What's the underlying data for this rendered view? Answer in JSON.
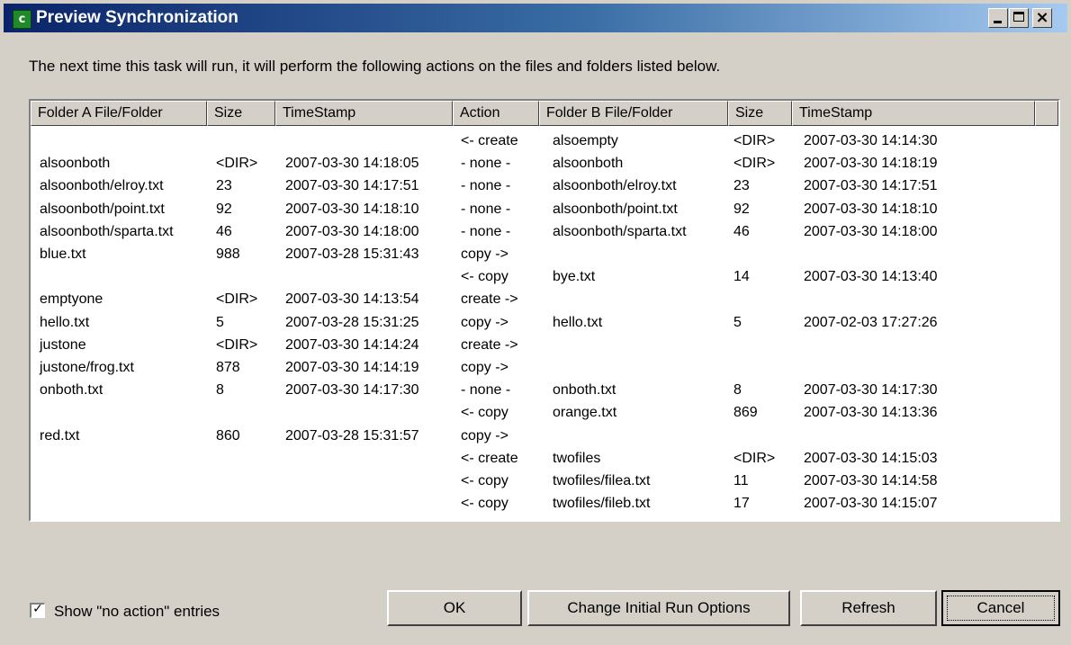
{
  "window": {
    "title": "Preview Synchronization"
  },
  "intro": "The next time this task will run, it will perform the following actions on the files and folders listed below.",
  "columns": [
    "Folder A File/Folder",
    "Size",
    "TimeStamp",
    "Action",
    "Folder B File/Folder",
    "Size",
    "TimeStamp"
  ],
  "rows": [
    [
      "",
      "",
      "",
      "<- create",
      "alsoempty",
      "<DIR>",
      "2007-03-30 14:14:30"
    ],
    [
      "alsoonboth",
      "<DIR>",
      "2007-03-30 14:18:05",
      "- none -",
      "alsoonboth",
      "<DIR>",
      "2007-03-30 14:18:19"
    ],
    [
      "alsoonboth/elroy.txt",
      "23",
      "2007-03-30 14:17:51",
      "- none -",
      "alsoonboth/elroy.txt",
      "23",
      "2007-03-30 14:17:51"
    ],
    [
      "alsoonboth/point.txt",
      "92",
      "2007-03-30 14:18:10",
      "- none -",
      "alsoonboth/point.txt",
      "92",
      "2007-03-30 14:18:10"
    ],
    [
      "alsoonboth/sparta.txt",
      "46",
      "2007-03-30 14:18:00",
      "- none -",
      "alsoonboth/sparta.txt",
      "46",
      "2007-03-30 14:18:00"
    ],
    [
      "blue.txt",
      "988",
      "2007-03-28 15:31:43",
      "copy ->",
      "",
      "",
      ""
    ],
    [
      "",
      "",
      "",
      "<- copy",
      "bye.txt",
      "14",
      "2007-03-30 14:13:40"
    ],
    [
      "emptyone",
      "<DIR>",
      "2007-03-30 14:13:54",
      "create ->",
      "",
      "",
      ""
    ],
    [
      "hello.txt",
      "5",
      "2007-03-28 15:31:25",
      "copy ->",
      "hello.txt",
      "5",
      "2007-02-03 17:27:26"
    ],
    [
      "justone",
      "<DIR>",
      "2007-03-30 14:14:24",
      "create ->",
      "",
      "",
      ""
    ],
    [
      "justone/frog.txt",
      "878",
      "2007-03-30 14:14:19",
      "copy ->",
      "",
      "",
      ""
    ],
    [
      "onboth.txt",
      "8",
      "2007-03-30 14:17:30",
      "- none -",
      "onboth.txt",
      "8",
      "2007-03-30 14:17:30"
    ],
    [
      "",
      "",
      "",
      "<- copy",
      "orange.txt",
      "869",
      "2007-03-30 14:13:36"
    ],
    [
      "red.txt",
      "860",
      "2007-03-28 15:31:57",
      "copy ->",
      "",
      "",
      ""
    ],
    [
      "",
      "",
      "",
      "<- create",
      "twofiles",
      "<DIR>",
      "2007-03-30 14:15:03"
    ],
    [
      "",
      "",
      "",
      "<- copy",
      "twofiles/filea.txt",
      "11",
      "2007-03-30 14:14:58"
    ],
    [
      "",
      "",
      "",
      "<- copy",
      "twofiles/fileb.txt",
      "17",
      "2007-03-30 14:15:07"
    ]
  ],
  "show_no_action": {
    "label": "Show \"no action\" entries",
    "checked": true
  },
  "buttons": {
    "ok": "OK",
    "change": "Change Initial Run Options",
    "refresh": "Refresh",
    "cancel": "Cancel"
  }
}
